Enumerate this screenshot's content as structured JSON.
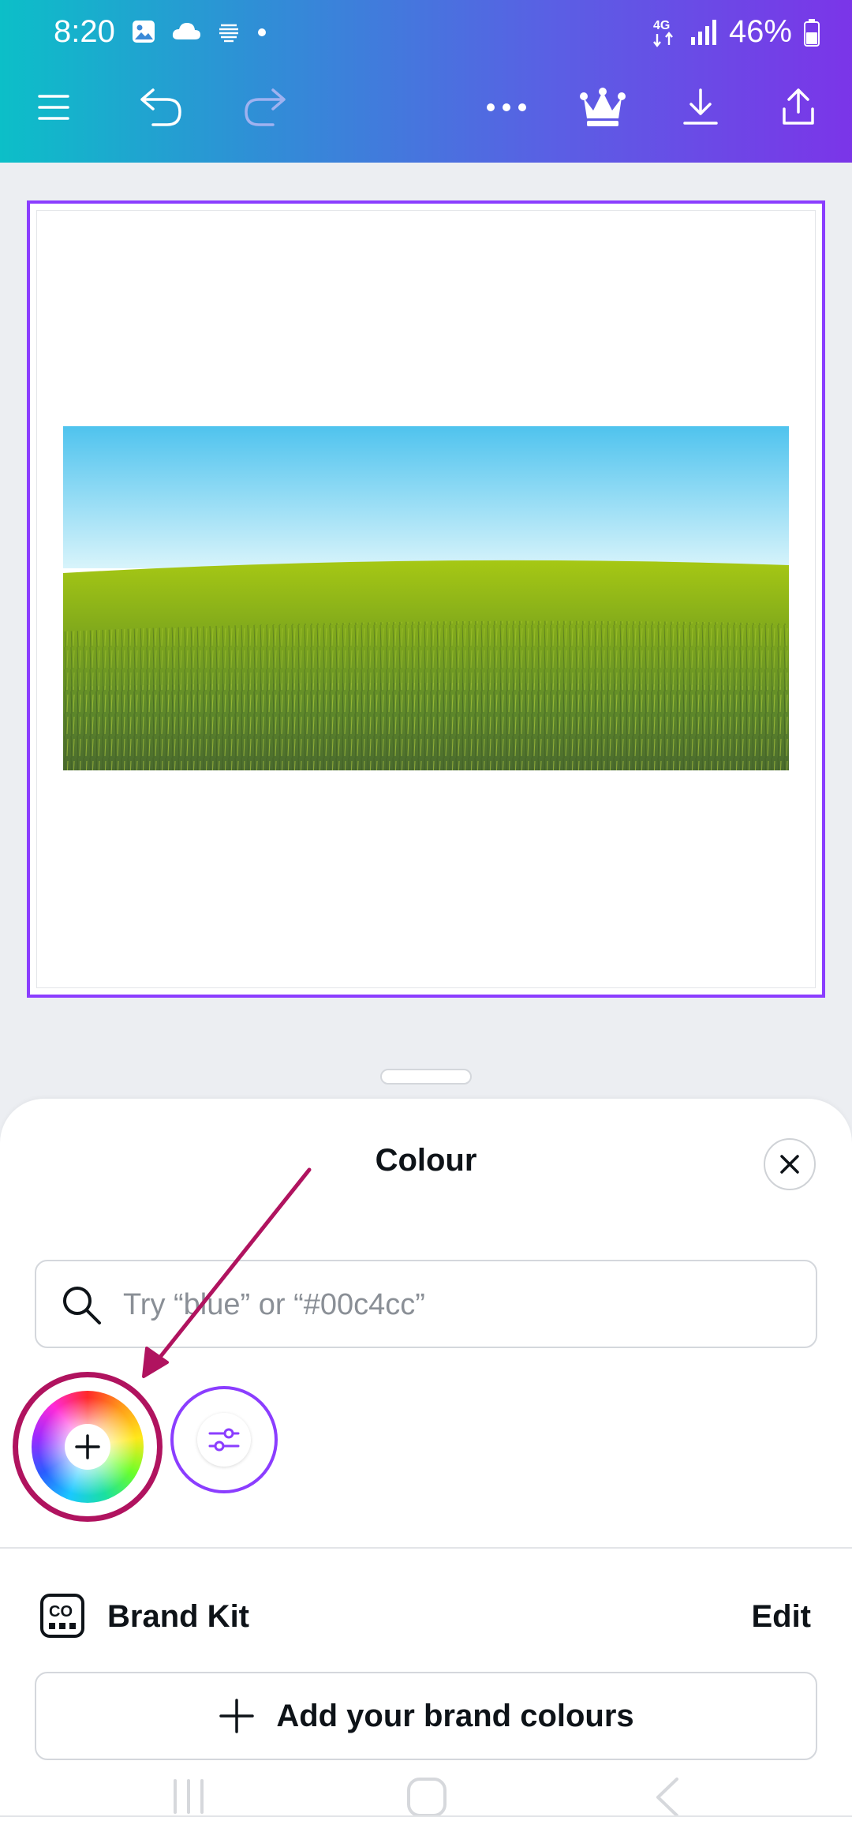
{
  "status_bar": {
    "time": "8:20",
    "network": "4G",
    "battery": "46%"
  },
  "toolbar": {
    "icons": [
      "menu-icon",
      "undo-icon",
      "redo-icon",
      "more-icon",
      "crown-icon",
      "download-icon",
      "share-icon"
    ]
  },
  "canvas": {
    "image_subject": "green-field-under-blue-sky",
    "selection_color": "#8b3dff"
  },
  "colour_panel": {
    "title": "Colour",
    "search_placeholder": "Try “blue” or “#00c4cc”",
    "search_value": "",
    "brand_kit_label": "Brand Kit",
    "edit_label": "Edit",
    "add_brand_label": "Add your brand colours"
  },
  "colors": {
    "accent": "#8b3dff",
    "annotation": "#b0135f",
    "header_gradient_start": "#0cbfc8",
    "header_gradient_end": "#7b35e8"
  }
}
